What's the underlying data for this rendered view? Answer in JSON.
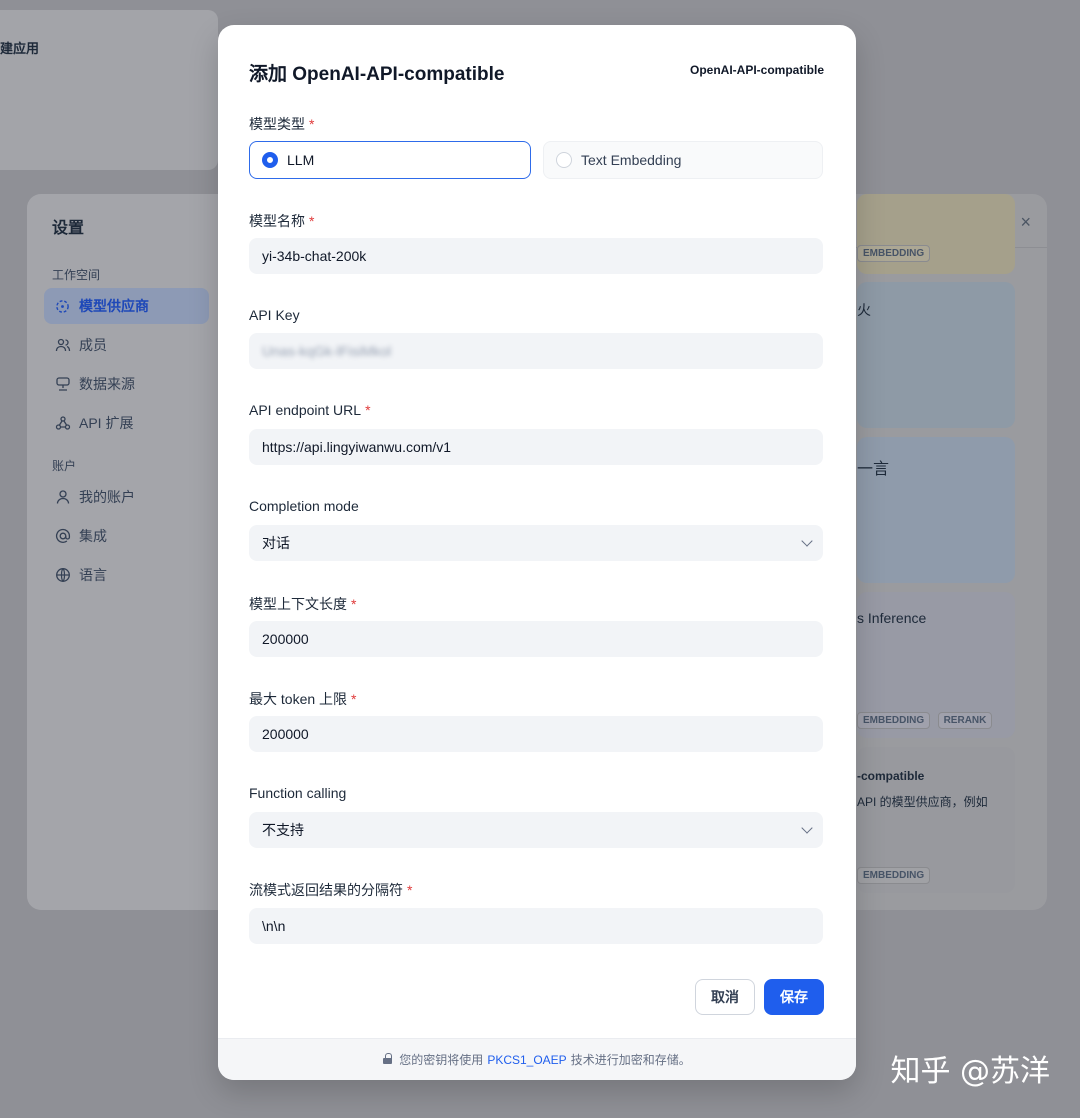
{
  "background": {
    "top_card_label": "建应用",
    "settings": {
      "title": "设置",
      "group_workspace": "工作空间",
      "group_account": "账户",
      "items": [
        {
          "label": "模型供应商",
          "icon": "provider-icon",
          "active": true
        },
        {
          "label": "成员",
          "icon": "members-icon"
        },
        {
          "label": "数据来源",
          "icon": "data-source-icon"
        },
        {
          "label": "API 扩展",
          "icon": "api-extension-icon"
        },
        {
          "label": "我的账户",
          "icon": "user-icon"
        },
        {
          "label": "集成",
          "icon": "at-icon"
        },
        {
          "label": "语言",
          "icon": "globe-icon"
        }
      ],
      "close": "×",
      "cards": [
        {
          "tags": [
            "EMBEDDING"
          ]
        },
        {
          "name": "火"
        },
        {
          "name": "一言"
        },
        {
          "name": "s Inference",
          "tags": [
            "EMBEDDING",
            "RERANK"
          ]
        },
        {
          "name": "-compatible",
          "desc": "API 的模型供应商，例如",
          "tags": [
            "EMBEDDING"
          ]
        }
      ]
    }
  },
  "modal": {
    "title": "添加 OpenAI-API-compatible",
    "provider_badge": "OpenAI-API-compatible",
    "model_type": {
      "label": "模型类型",
      "options": [
        "LLM",
        "Text Embedding"
      ],
      "selected": "LLM"
    },
    "model_name": {
      "label": "模型名称",
      "value": "yi-34b-chat-200k"
    },
    "api_key": {
      "label": "API Key",
      "value": "Unas-kqGk-lFisiMkol"
    },
    "endpoint": {
      "label": "API endpoint URL",
      "value": "https://api.lingyiwanwu.com/v1"
    },
    "completion_mode": {
      "label": "Completion mode",
      "value": "对话"
    },
    "context_length": {
      "label": "模型上下文长度",
      "value": "200000"
    },
    "max_tokens": {
      "label": "最大 token 上限",
      "value": "200000"
    },
    "function_calling": {
      "label": "Function calling",
      "value": "不支持"
    },
    "stream_delimiter": {
      "label": "流模式返回结果的分隔符",
      "value": "\\n\\n"
    },
    "buttons": {
      "cancel": "取消",
      "save": "保存"
    },
    "footer": {
      "prefix": "您的密钥将使用",
      "link": "PKCS1_OAEP",
      "suffix": "技术进行加密和存储。"
    },
    "required_mark": "*"
  },
  "watermark": "知乎 @苏洋",
  "colors": {
    "accent": "#1f5eed",
    "required": "#e03a3a"
  }
}
